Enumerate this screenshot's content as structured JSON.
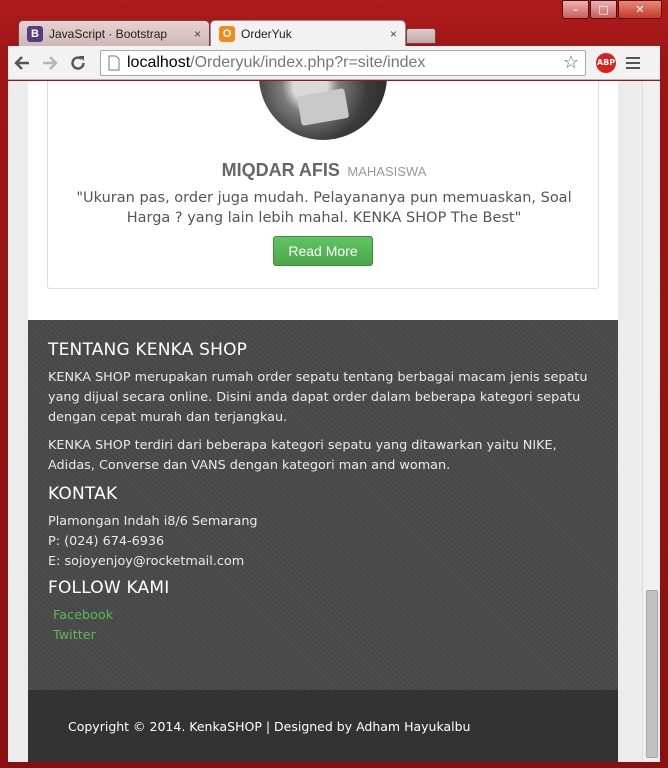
{
  "browser": {
    "tabs": [
      {
        "label": "JavaScript · Bootstrap",
        "favicon": "B",
        "favicon_color": "#563d7c",
        "active": false
      },
      {
        "label": "OrderYuk",
        "favicon": "O",
        "favicon_color": "#f08c1a",
        "active": true
      }
    ],
    "tab_close_glyph": "×",
    "address": {
      "host": "localhost",
      "path": "/Orderyuk/index.php?r=site/index"
    },
    "icons": {
      "back": "arrow-left-icon",
      "forward": "arrow-right-icon",
      "reload": "reload-icon",
      "bookmark": "star-icon",
      "adblock": "abp-icon",
      "menu": "hamburger-menu-icon"
    },
    "adblock_label": "ABP"
  },
  "testimonial": {
    "name": "MIQDAR AFIS",
    "role": "MAHASISWA",
    "quote": "\"Ukuran pas, order juga mudah. Pelayananya pun memuaskan, Soal Harga ? yang lain lebih mahal. KENKA SHOP The Best\"",
    "button_label": "Read More",
    "button_color": "#5cb85c"
  },
  "footer": {
    "about_title": "TENTANG KENKA SHOP",
    "about_p1": "KENKA SHOP merupakan rumah order sepatu tentang berbagai macam jenis sepatu yang dijual secara online. Disini anda dapat order dalam beberapa kategori sepatu dengan cepat murah dan terjangkau.",
    "about_p2": "KENKA SHOP terdiri dari beberapa kategori sepatu yang ditawarkan yaitu NIKE, Adidas, Converse dan VANS dengan kategori man and woman.",
    "contact_title": "KONTAK",
    "contact_address": "Plamongan Indah i8/6 Semarang",
    "contact_phone": "P: (024) 674-6936",
    "contact_email": "E: sojoyenjoy@rocketmail.com",
    "follow_title": "FOLLOW KAMI",
    "links": [
      "Facebook",
      "Twitter"
    ],
    "link_color": "#5cb85c"
  },
  "copyright": "Copyright © 2014. KenkaSHOP | Designed by Adham Hayukalbu"
}
